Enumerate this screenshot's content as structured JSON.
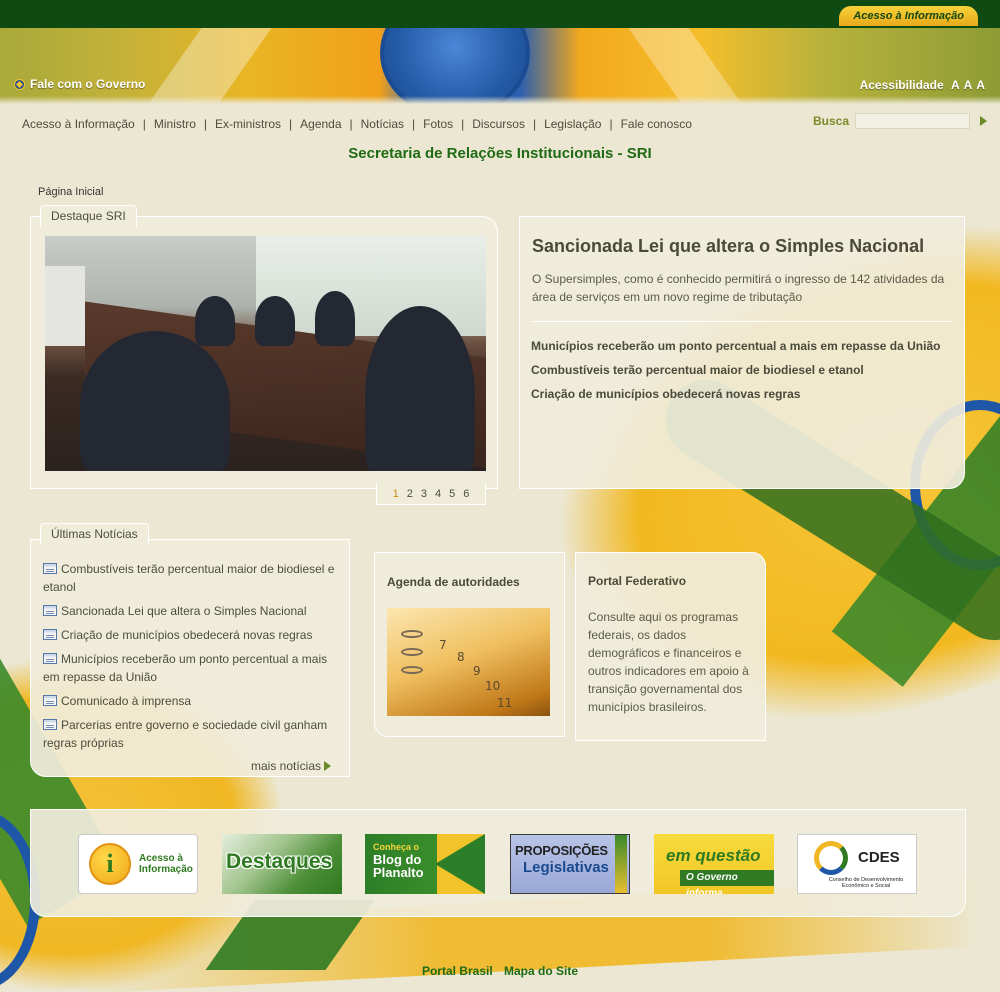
{
  "header": {
    "acesso_tab": "Acesso à Informação",
    "fale": "Fale com o Governo",
    "acessibilidade": "Acessibilidade",
    "font_sizes": [
      "A",
      "A",
      "A"
    ]
  },
  "nav": {
    "items": [
      "Acesso à Informação",
      "Ministro",
      "Ex-ministros",
      "Agenda",
      "Notícias",
      "Fotos",
      "Discursos",
      "Legislação",
      "Fale conosco"
    ],
    "separator": "|"
  },
  "search": {
    "label": "Busca",
    "value": ""
  },
  "page": {
    "title": "Secretaria de Relações Institucionais - SRI",
    "breadcrumb": "Página Inicial"
  },
  "destaque": {
    "tab": "Destaque SRI",
    "pages": [
      "1",
      "2",
      "3",
      "4",
      "5",
      "6"
    ],
    "active_page": "1"
  },
  "story": {
    "title": "Sancionada Lei que altera o Simples Nacional",
    "description": "O Supersimples, como é conhecido permitirá o ingresso de 142 atividades da área de serviços em um novo regime de tributação",
    "links": [
      "Municípios receberão um ponto percentual a mais em repasse da União",
      "Combustíveis terão percentual maior de biodiesel e etanol",
      "Criação de municípios obedecerá novas regras"
    ]
  },
  "news": {
    "tab": "Últimas Notícias",
    "items": [
      "Combustíveis terão percentual maior de biodiesel e etanol",
      "Sancionada Lei que altera o Simples Nacional",
      "Criação de municípios obedecerá novas regras",
      "Municípios receberão um ponto percentual a mais em repasse da União",
      "Comunicado à imprensa",
      "Parcerias entre governo e sociedade civil ganham regras próprias"
    ],
    "more": "mais notícias"
  },
  "agenda": {
    "title": "Agenda de autoridades",
    "calendar_numbers": [
      "7",
      "8",
      "9",
      "10",
      "11"
    ]
  },
  "portal": {
    "title": "Portal Federativo",
    "description": "Consulte aqui os programas federais, os dados demográficos e financeiros e outros indicadores em apoio à transição governamental dos municípios brasileiros."
  },
  "banners": {
    "acesso": {
      "icon": "i",
      "text1": "Acesso à",
      "text2": "Informação"
    },
    "destaques": {
      "text": "Destaques"
    },
    "blog": {
      "text1": "Conheça o",
      "text2": "Blog do",
      "text3": "Planalto"
    },
    "proposicoes": {
      "text1": "PROPOSIÇÕES",
      "text2": "Legislativas"
    },
    "em_questao": {
      "text1": "em questão",
      "text2": "O Governo informa"
    },
    "cdes": {
      "text": "CDES",
      "sub": "Conselho de Desenvolvimento Econômico e Social"
    }
  },
  "footer": {
    "links": [
      "Portal Brasil",
      "Mapa do Site"
    ]
  },
  "colors": {
    "top_bar": "#0f4a12",
    "title_green": "#1f6a14",
    "busca_label": "#7a8a2c",
    "page_bg": "#ebe7d2",
    "active_page": "#d18a10"
  }
}
